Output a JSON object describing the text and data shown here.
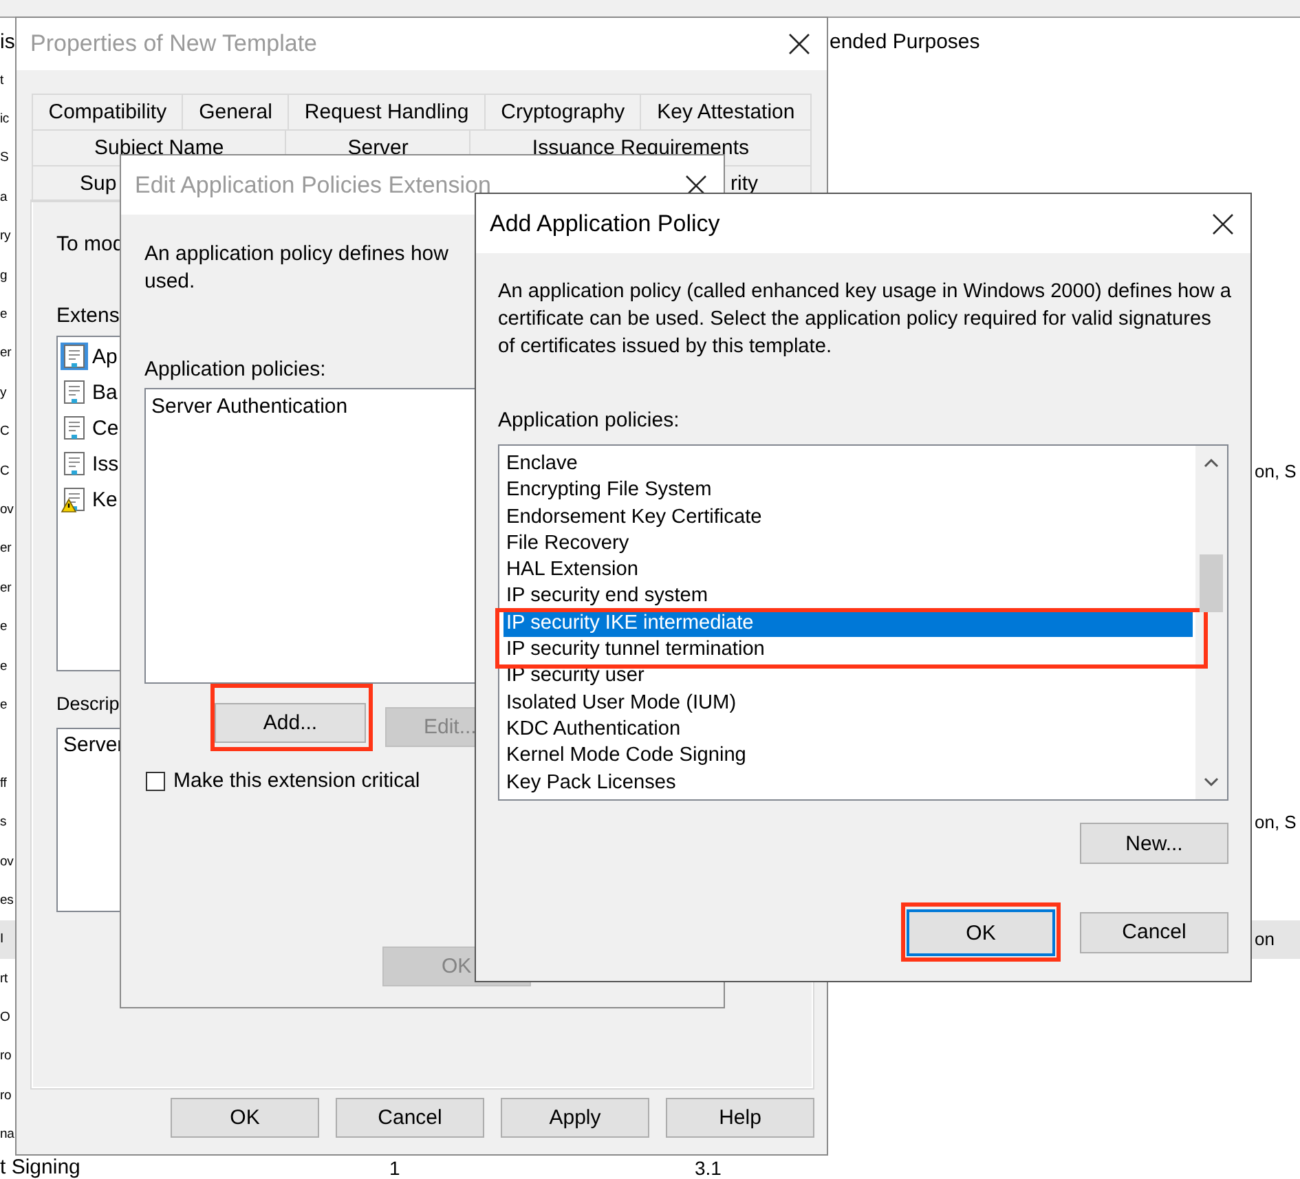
{
  "background_window": {
    "header": {
      "column_1": "is",
      "column_2": "ended Purposes"
    },
    "rows": [
      {
        "column_1": "t",
        "selected": false
      },
      {
        "column_1": "ic",
        "selected": false
      },
      {
        "column_1": "S",
        "selected": false
      },
      {
        "column_1": "a",
        "selected": false
      },
      {
        "column_1": "ry",
        "selected": false
      },
      {
        "column_1": "g",
        "selected": false
      },
      {
        "column_1": "e",
        "selected": false
      },
      {
        "column_1": "er",
        "selected": false
      },
      {
        "column_1": "y",
        "selected": false
      },
      {
        "column_1": "C",
        "selected": false
      },
      {
        "column_1": "C",
        "column_4": "on, S",
        "selected": false
      },
      {
        "column_1": "ov",
        "selected": false
      },
      {
        "column_1": "er",
        "selected": false
      },
      {
        "column_1": "er",
        "selected": false
      },
      {
        "column_1": "e",
        "selected": false
      },
      {
        "column_1": "e",
        "selected": false
      },
      {
        "column_1": "e",
        "selected": false
      },
      {
        "selected": false
      },
      {
        "column_1": "ff",
        "selected": false
      },
      {
        "column_1": "s",
        "column_4": "on, S",
        "selected": false
      },
      {
        "column_1": "ov",
        "selected": false
      },
      {
        "column_1": "es",
        "selected": false
      },
      {
        "column_1": "I",
        "column_4": "on",
        "selected": true
      },
      {
        "column_1": "rt",
        "selected": false
      },
      {
        "column_1": "O",
        "selected": false
      },
      {
        "column_1": "ro",
        "selected": false
      },
      {
        "column_1": "ro",
        "selected": false
      },
      {
        "column_1": "na",
        "selected": false
      },
      {
        "column_1": "t Signing",
        "column_2": "1",
        "column_3": "3.1",
        "selected": false
      }
    ]
  },
  "properties_window": {
    "title": "Properties of New Template",
    "active": false,
    "tab_rows": [
      [
        {
          "label": "Compatibility",
          "selected": false
        },
        {
          "label": "General",
          "selected": false
        },
        {
          "label": "Request Handling",
          "selected": false
        },
        {
          "label": "Cryptography",
          "selected": false
        },
        {
          "label": "Key Attestation",
          "selected": false
        }
      ],
      [
        {
          "label": "Subject Name",
          "selected": false
        },
        {
          "label": "Server",
          "selected": false
        },
        {
          "label": "Issuance Requirements",
          "selected": false
        }
      ],
      [
        {
          "label": "Sup",
          "selected": false
        },
        {
          "label": "rity",
          "selected": false
        }
      ]
    ],
    "intro": "To mod",
    "extensions_label": "Extens",
    "extensions": [
      {
        "label": "Ap",
        "kind": "document",
        "selected": true
      },
      {
        "label": "Ba",
        "kind": "document",
        "selected": false
      },
      {
        "label": "Ce",
        "kind": "document",
        "selected": false
      },
      {
        "label": "Iss",
        "kind": "document",
        "selected": false
      },
      {
        "label": "Ke",
        "kind": "warning",
        "selected": false
      }
    ],
    "description_label": "Descrip",
    "description": "Server",
    "buttons": [
      {
        "label": "OK"
      },
      {
        "label": "Cancel"
      },
      {
        "label": "Apply"
      },
      {
        "label": "Help"
      }
    ]
  },
  "edit_dialog": {
    "title": "Edit Application Policies Extension",
    "active": false,
    "description_lines": [
      "An application policy defines how",
      "used."
    ],
    "policies_label": "Application policies:",
    "policies": [
      {
        "label": "Server Authentication",
        "selected": false
      }
    ],
    "buttons": [
      {
        "label": "Add...",
        "disabled": false,
        "highlighted": true
      },
      {
        "label": "Edit...",
        "disabled": true,
        "highlighted": false
      }
    ],
    "critical_checkbox": {
      "label": "Make this extension critical",
      "checked": false
    },
    "footer_buttons": [
      {
        "label": "OK",
        "disabled": true
      }
    ]
  },
  "add_dialog": {
    "title": "Add Application Policy",
    "active": true,
    "description": "An application policy (called enhanced key usage in Windows 2000) defines how a certificate can be used. Select the application policy required for valid signatures of certificates issued by this template.",
    "policies_label": "Application policies:",
    "policies": [
      {
        "label": "Enclave",
        "selected": false,
        "highlighted": false
      },
      {
        "label": "Encrypting File System",
        "selected": false,
        "highlighted": false
      },
      {
        "label": "Endorsement Key Certificate",
        "selected": false,
        "highlighted": false
      },
      {
        "label": "File Recovery",
        "selected": false,
        "highlighted": false
      },
      {
        "label": "HAL Extension",
        "selected": false,
        "highlighted": false
      },
      {
        "label": "IP security end system",
        "selected": false,
        "highlighted": false
      },
      {
        "label": "IP security IKE intermediate",
        "selected": true,
        "highlighted": true
      },
      {
        "label": "IP security tunnel termination",
        "selected": false,
        "highlighted": false
      },
      {
        "label": "IP security user",
        "selected": false,
        "highlighted": false
      },
      {
        "label": "Isolated User Mode (IUM)",
        "selected": false,
        "highlighted": false
      },
      {
        "label": "KDC Authentication",
        "selected": false,
        "highlighted": false
      },
      {
        "label": "Kernel Mode Code Signing",
        "selected": false,
        "highlighted": false
      },
      {
        "label": "Key Pack Licenses",
        "selected": false,
        "highlighted": false
      }
    ],
    "new_button": {
      "label": "New..."
    },
    "footer_buttons": [
      {
        "label": "OK",
        "default": true,
        "highlighted": true
      },
      {
        "label": "Cancel",
        "default": false,
        "highlighted": false
      }
    ]
  }
}
